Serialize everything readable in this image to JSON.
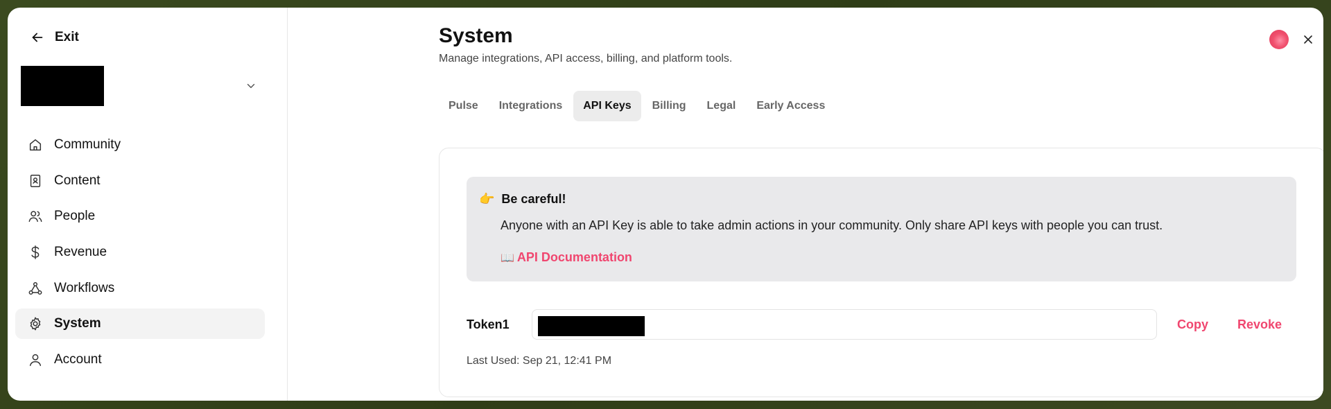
{
  "sidebar": {
    "exit_label": "Exit",
    "items": [
      {
        "label": "Community",
        "icon": "home-icon"
      },
      {
        "label": "Content",
        "icon": "content-icon"
      },
      {
        "label": "People",
        "icon": "people-icon"
      },
      {
        "label": "Revenue",
        "icon": "dollar-icon"
      },
      {
        "label": "Workflows",
        "icon": "workflow-icon"
      },
      {
        "label": "System",
        "icon": "gear-icon",
        "active": true
      },
      {
        "label": "Account",
        "icon": "user-icon"
      }
    ]
  },
  "header": {
    "title": "System",
    "subtitle": "Manage integrations, API access, billing, and platform tools."
  },
  "tabs": [
    {
      "label": "Pulse"
    },
    {
      "label": "Integrations"
    },
    {
      "label": "API Keys",
      "active": true
    },
    {
      "label": "Billing"
    },
    {
      "label": "Legal"
    },
    {
      "label": "Early Access"
    }
  ],
  "warning": {
    "icon": "👉",
    "title": "Be careful!",
    "body": "Anyone with an API Key is able to take admin actions in your community. Only share API keys with people you can trust.",
    "link_icon": "📖",
    "link_label": "API Documentation"
  },
  "token": {
    "label": "Token1",
    "copy_label": "Copy",
    "revoke_label": "Revoke",
    "last_used": "Last Used: Sep 21, 12:41 PM"
  },
  "colors": {
    "accent": "#f0466f",
    "active_bg": "#f3f3f3",
    "warning_bg": "#e9e9eb"
  }
}
